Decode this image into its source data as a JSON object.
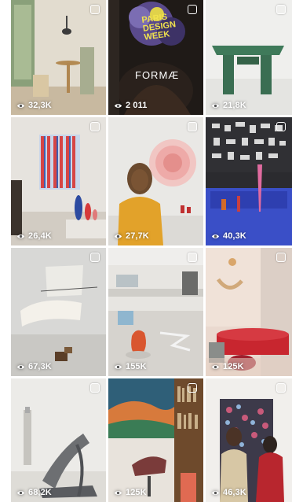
{
  "grid": {
    "tiles": [
      {
        "views": "32,3K",
        "selectable": true
      },
      {
        "views": "2 011",
        "selectable": true,
        "poster": {
          "line1": "PARIS",
          "line2": "DESIGN",
          "line3": "WEEK",
          "brand": "FORMÆ"
        }
      },
      {
        "views": "21,8K",
        "selectable": true
      },
      {
        "views": "26,4K",
        "selectable": true
      },
      {
        "views": "27,7K",
        "selectable": true
      },
      {
        "views": "40,3K",
        "selectable": true
      },
      {
        "views": "67,3K",
        "selectable": true
      },
      {
        "views": "155K",
        "selectable": true
      },
      {
        "views": "125K",
        "selectable": true
      },
      {
        "views": "68,2K",
        "selectable": true
      },
      {
        "views": "125K",
        "selectable": true
      },
      {
        "views": "46,3K",
        "selectable": true
      }
    ]
  },
  "icons": {
    "views": "eye-icon",
    "select": "checkbox-icon"
  }
}
